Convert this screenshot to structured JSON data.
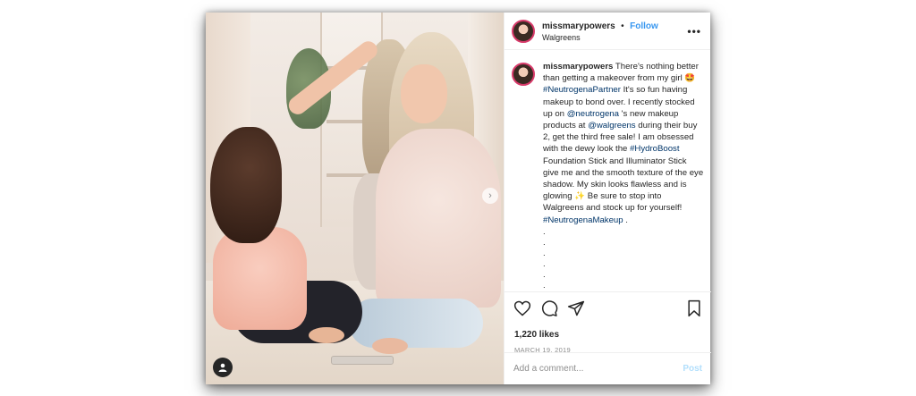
{
  "post": {
    "username": "missmarypowers",
    "separator": "•",
    "follow_label": "Follow",
    "location": "Walgreens",
    "more_label": "•••"
  },
  "caption": {
    "username": "missmarypowers",
    "text_1": " There's nothing better than getting a makeover from my girl 🤩 ",
    "tag_1": "#NeutrogenaPartner",
    "text_2": " It's so fun having makeup to bond over. I recently stocked up on ",
    "mention_1": "@neutrogena",
    "text_3": " 's new makeup products at ",
    "mention_2": "@walgreens",
    "text_4": " during their buy 2, get the third free sale! I am obsessed with the dewy look the ",
    "tag_2": "#HydroBoost",
    "text_5": " Foundation Stick and Illuminator Stick give me and the smooth texture of the eye shadow. My skin looks flawless and is glowing ✨ Be sure to stop into Walgreens and stock up for yourself! ",
    "tag_3": "#NeutrogenaMakeup",
    "text_6": " .",
    "dots": [
      ".",
      ".",
      ".",
      ".",
      ".",
      "."
    ]
  },
  "actions": {
    "likes": "1,220 likes",
    "date": "MARCH 19, 2019"
  },
  "comment": {
    "placeholder": "Add a comment...",
    "post_label": "Post"
  },
  "icons": {
    "photo_next": "chevron-right-icon",
    "tag": "user-tag-icon",
    "like": "heart-icon",
    "comment": "comment-icon",
    "share": "share-icon",
    "save": "bookmark-icon"
  },
  "colors": {
    "follow": "#3897f0",
    "link": "#003569",
    "post_disabled": "#b2dffc",
    "muted": "#8e8e8e"
  }
}
